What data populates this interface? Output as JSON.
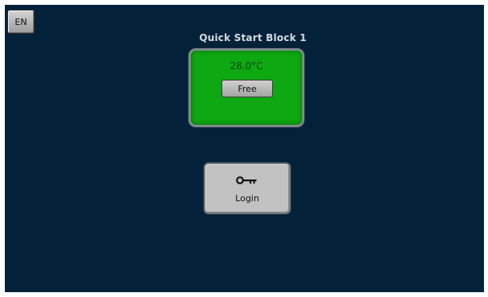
{
  "language_button": {
    "label": "EN"
  },
  "block": {
    "title": "Quick Start Block 1",
    "temperature": "28.0°C",
    "status_label": "Free",
    "status_color": "#0ea812"
  },
  "login": {
    "label": "Login",
    "icon": "key-icon"
  },
  "colors": {
    "background": "#03223a",
    "panel_green": "#0ea812",
    "button_gray": "#c3c3c3"
  }
}
